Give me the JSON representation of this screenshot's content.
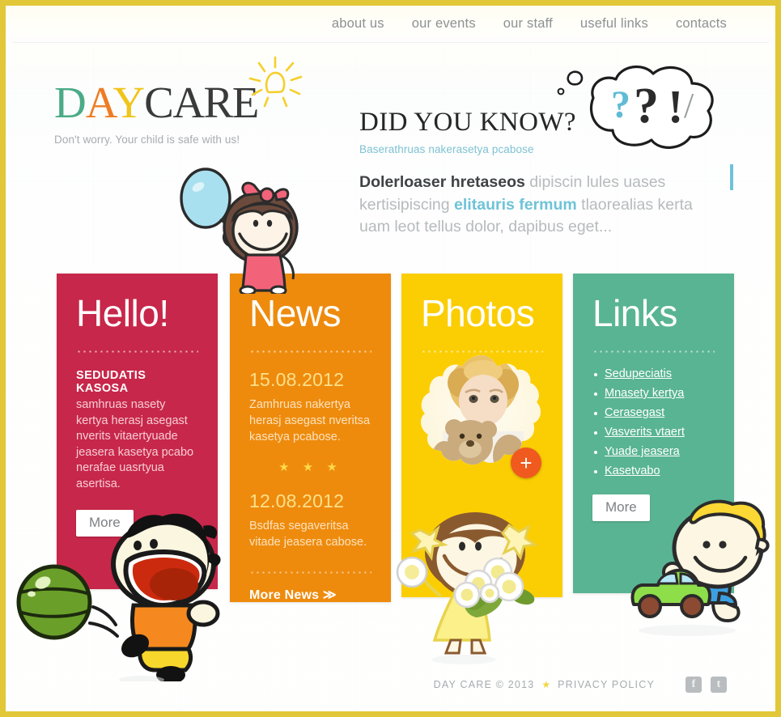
{
  "nav": {
    "items": [
      {
        "label": "about us"
      },
      {
        "label": "our events"
      },
      {
        "label": "our staff"
      },
      {
        "label": "useful links"
      },
      {
        "label": "contacts"
      }
    ]
  },
  "logo": {
    "d": "D",
    "a": "A",
    "y": "Y",
    "care": "CARE",
    "tagline": "Don't worry. Your child is safe with us!",
    "color_d": "#4aab86",
    "color_a": "#ef7c23",
    "color_y": "#f0c419",
    "color_care": "#3a3a3a"
  },
  "did_you_know": {
    "title": "DID YOU KNOW?",
    "subtitle": "Baserathruas nakerasetya pcabose",
    "body_part1": "Dolerloaser hretaseos",
    "body_part2": " dipiscin lules uases kertisipiscing ",
    "body_part3": "elitauris fermum",
    "body_part4": " tlaorealias kerta uam leot tellus dolor, dapibus eget...",
    "bubble_marks": [
      "?",
      "?",
      "!",
      "/"
    ]
  },
  "panels": {
    "hello": {
      "title": "Hello!",
      "color": "#c7274a",
      "subtitle": "SEDUDATIS KASOSA",
      "body": "samhruas nasety kertya herasj asegast nverits vitaertyuade jeasera kasetya pcabo nerafae uasrtyua asertisa.",
      "button": "More"
    },
    "news": {
      "title": "News",
      "color": "#ee8b0d",
      "items": [
        {
          "date": "15.08.2012",
          "text": "Zamhruas nakertya herasj asegast nveritsa kasetya pcabose."
        },
        {
          "date": "12.08.2012",
          "text": "Bsdfas segaveritsa vitade jeasera cabose."
        }
      ],
      "stars": "★ ★ ★",
      "more_label": "More News ≫"
    },
    "photos": {
      "title": "Photos",
      "color": "#fbce04",
      "add_label": "+",
      "photo_caption": "child holding teddy bear"
    },
    "links": {
      "title": "Links",
      "color": "#59b493",
      "items": [
        {
          "label": "Sedupeciatis"
        },
        {
          "label": "Mnasety kertya"
        },
        {
          "label": "Cerasegast"
        },
        {
          "label": "Vasverits vtaert"
        },
        {
          "label": "Yuade jeasera"
        },
        {
          "label": "Kasetvabo"
        }
      ],
      "button": "More"
    }
  },
  "footer": {
    "copyright": "DAY CARE © 2013",
    "star": "★",
    "privacy": "PRIVACY POLICY",
    "social": [
      {
        "name": "facebook",
        "glyph": "f"
      },
      {
        "name": "twitter",
        "glyph": "t"
      }
    ]
  }
}
